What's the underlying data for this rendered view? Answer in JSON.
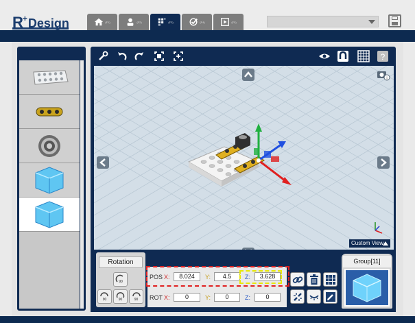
{
  "app": {
    "logo_main": "R",
    "logo_plus": "+",
    "logo_text": "Design"
  },
  "tabs": [
    {
      "name": "home",
      "key": "(F1)"
    },
    {
      "name": "assemble",
      "key": "(F2)"
    },
    {
      "name": "motion",
      "key": "(F3)"
    },
    {
      "name": "task",
      "key": "(F4)"
    },
    {
      "name": "play",
      "key": "(F5)"
    }
  ],
  "active_tab": "motion",
  "library": {
    "items": [
      "plate-part",
      "link-part",
      "gear-part",
      "cube-part",
      "cube-part-selected"
    ]
  },
  "viewport": {
    "custom_view_label": "Custom View",
    "scene": "plate with yellow joints and gizmo arrows on 3D grid"
  },
  "rotation": {
    "title": "Rotation",
    "angle_label": "90"
  },
  "transform": {
    "pos_label": "POS",
    "rot_label": "ROT",
    "x_label": "X:",
    "y_label": "Y:",
    "z_label": "Z:",
    "pos": {
      "x": "8.024",
      "y": "4.5",
      "z": "3.628"
    },
    "rot": {
      "x": "0",
      "y": "0",
      "z": "0"
    }
  },
  "group": {
    "title": "Group[11]"
  },
  "colors": {
    "navy": "#0f2a52",
    "pos_x": "#d03030",
    "pos_y": "#c8a020",
    "pos_z": "#3060c8"
  }
}
